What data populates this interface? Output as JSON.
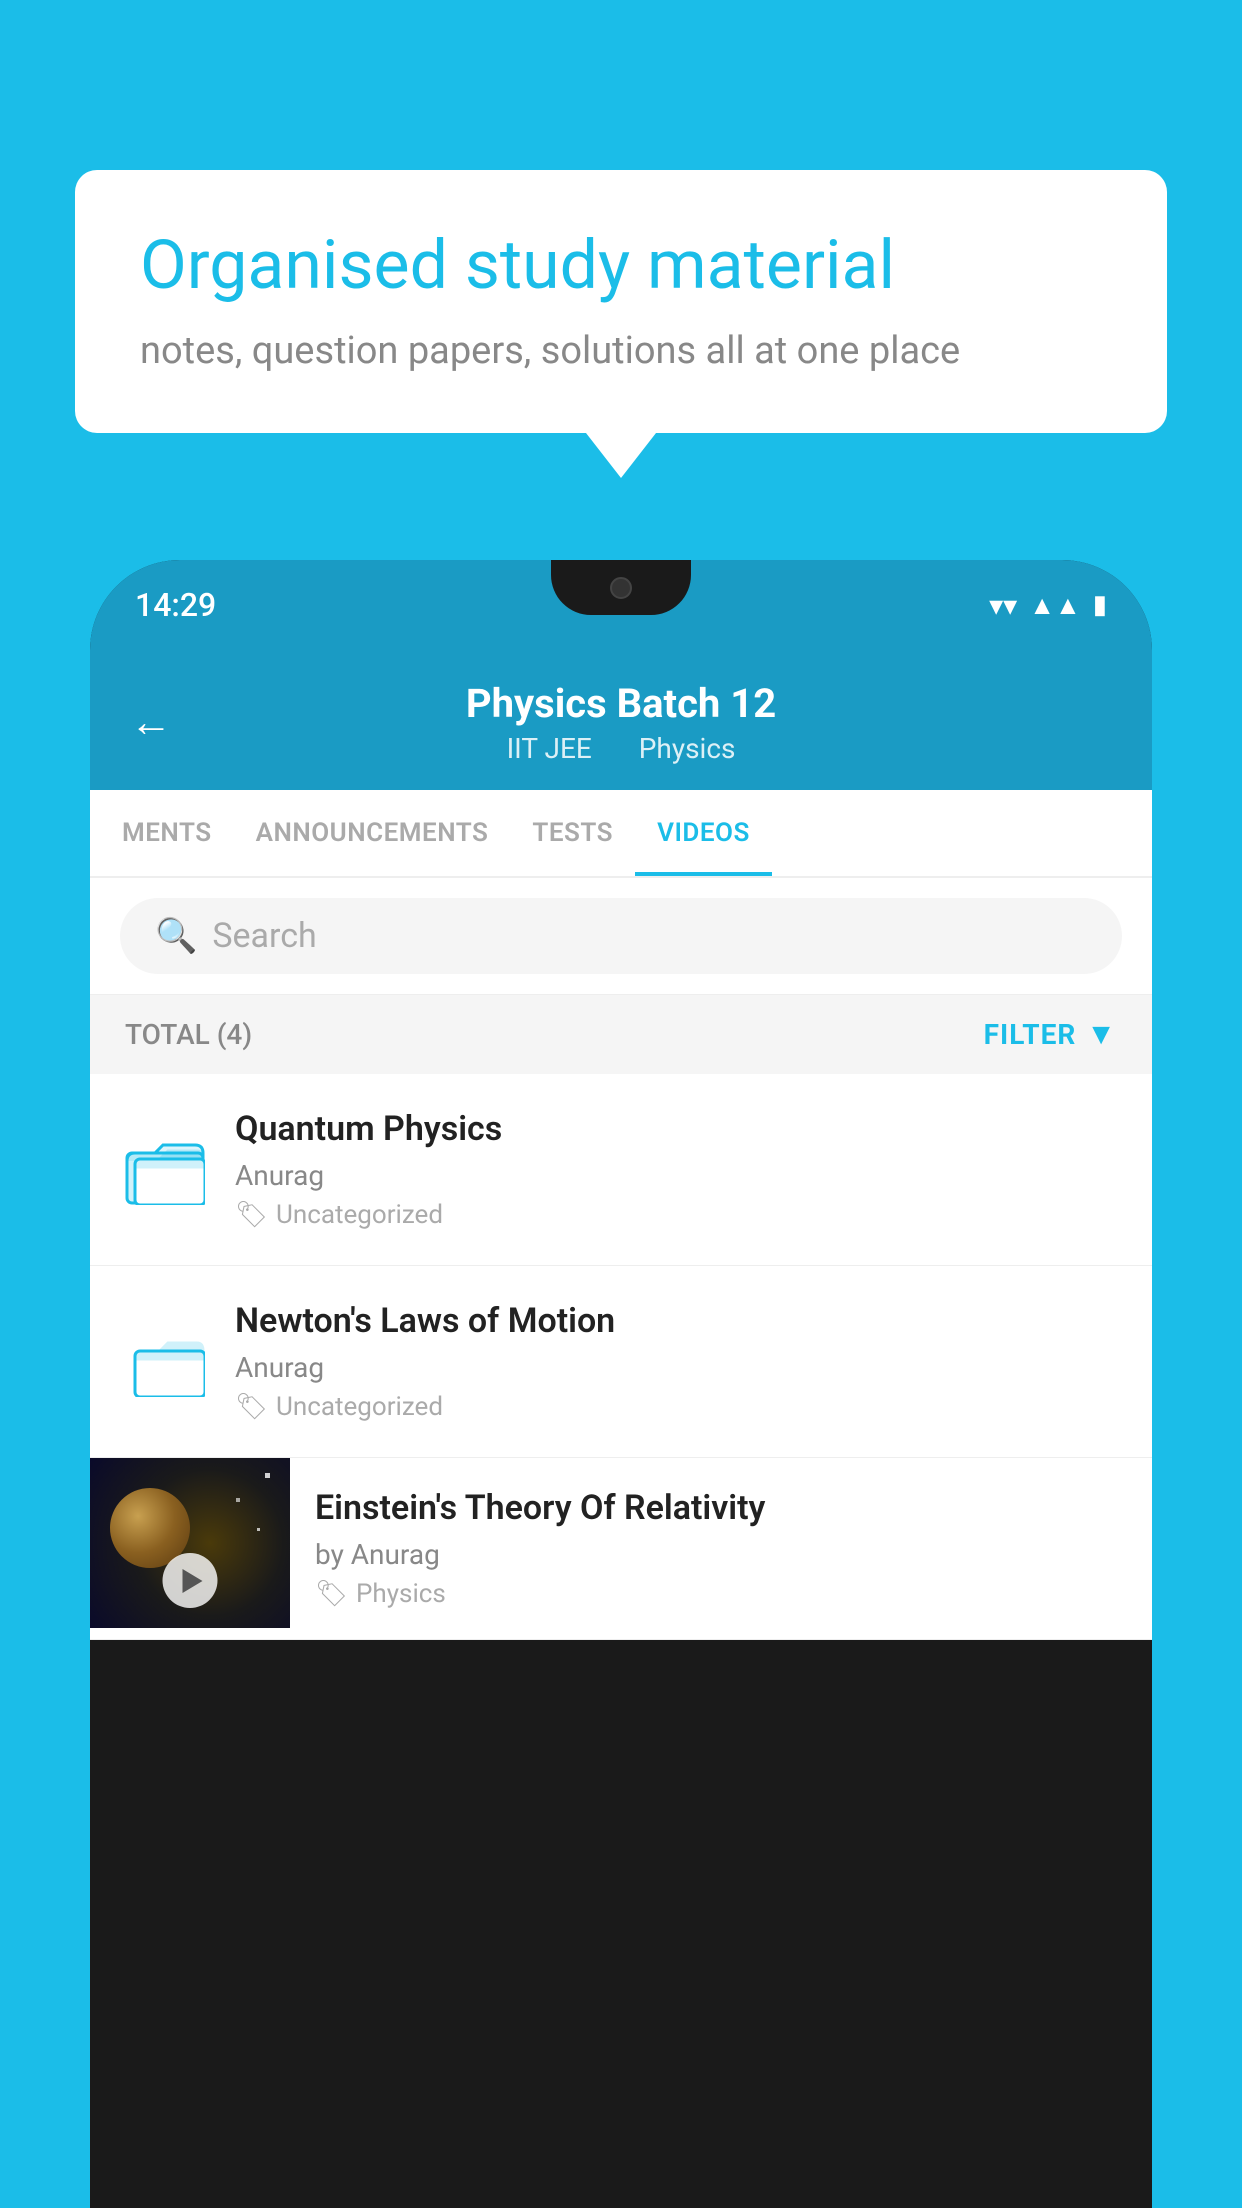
{
  "background": {
    "color": "#1BBDE8"
  },
  "speech_bubble": {
    "title": "Organised study material",
    "subtitle": "notes, question papers, solutions all at one place"
  },
  "phone": {
    "status_bar": {
      "time": "14:29",
      "wifi_icon": "wifi",
      "signal_icon": "signal",
      "battery_icon": "battery"
    },
    "header": {
      "back_label": "←",
      "title": "Physics Batch 12",
      "subtitle_part1": "IIT JEE",
      "subtitle_part2": "Physics"
    },
    "tabs": [
      {
        "label": "MENTS",
        "active": false
      },
      {
        "label": "ANNOUNCEMENTS",
        "active": false
      },
      {
        "label": "TESTS",
        "active": false
      },
      {
        "label": "VIDEOS",
        "active": true
      }
    ],
    "search": {
      "placeholder": "Search"
    },
    "filter": {
      "total_label": "TOTAL (4)",
      "filter_label": "FILTER"
    },
    "videos": [
      {
        "id": 1,
        "title": "Quantum Physics",
        "author": "Anurag",
        "category": "Uncategorized",
        "has_thumbnail": false
      },
      {
        "id": 2,
        "title": "Newton's Laws of Motion",
        "author": "Anurag",
        "category": "Uncategorized",
        "has_thumbnail": false
      },
      {
        "id": 3,
        "title": "Einstein's Theory Of Relativity",
        "author": "by Anurag",
        "category": "Physics",
        "has_thumbnail": true
      }
    ]
  }
}
